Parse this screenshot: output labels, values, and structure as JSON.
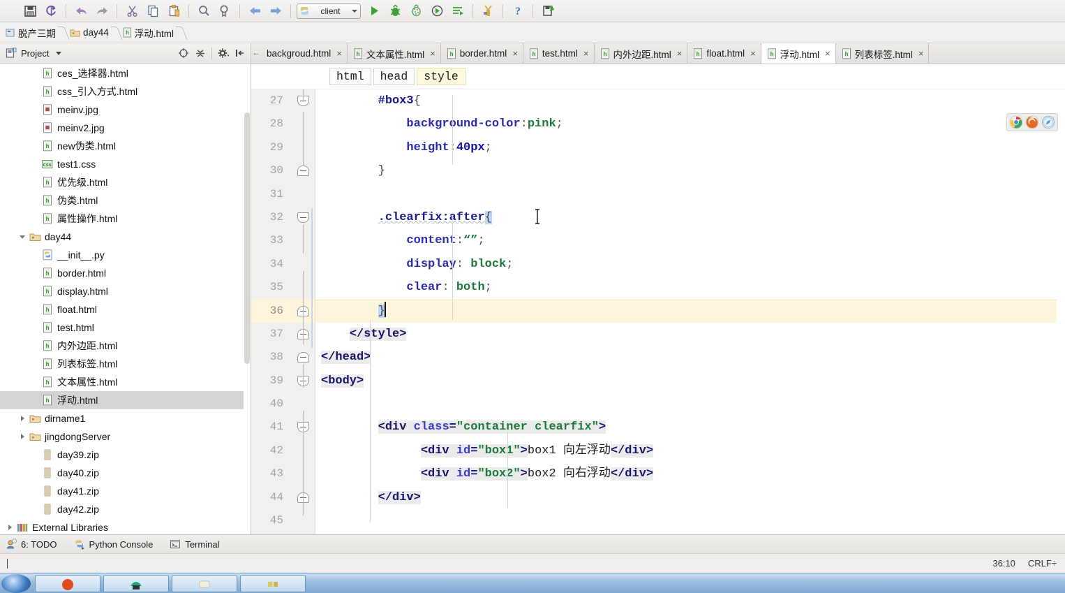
{
  "toolbar": {
    "icons": [
      {
        "name": "save-all-icon",
        "title": "Save All"
      },
      {
        "name": "sync-refresh-icon",
        "title": "Synchronize"
      },
      {
        "name": "undo-icon",
        "title": "Undo"
      },
      {
        "name": "redo-icon",
        "title": "Redo"
      },
      {
        "name": "cut-icon",
        "title": "Cut"
      },
      {
        "name": "copy-icon",
        "title": "Copy"
      },
      {
        "name": "paste-icon",
        "title": "Paste"
      },
      {
        "name": "find-icon",
        "title": "Find"
      },
      {
        "name": "replace-icon",
        "title": "Replace"
      },
      {
        "name": "back-icon",
        "title": "Back"
      },
      {
        "name": "forward-icon",
        "title": "Forward"
      }
    ],
    "run_config": "client",
    "run_icons": [
      {
        "name": "run-icon",
        "title": "Run"
      },
      {
        "name": "debug-icon",
        "title": "Debug"
      },
      {
        "name": "coverage-icon",
        "title": "Run with Coverage"
      },
      {
        "name": "profile-icon",
        "title": "Profile"
      },
      {
        "name": "run-console-icon",
        "title": "Run Console"
      },
      {
        "name": "attach-process-icon",
        "title": "Attach"
      },
      {
        "name": "help-icon",
        "title": "Help"
      },
      {
        "name": "deploy-icon",
        "title": "Deploy"
      }
    ]
  },
  "breadcrumb": {
    "items": [
      {
        "label": "脱产三期",
        "icon": "project-icon"
      },
      {
        "label": "day44",
        "icon": "folder-icon"
      },
      {
        "label": "浮动.html",
        "icon": "html-file-icon"
      }
    ]
  },
  "sidebar": {
    "panel_title": "Project",
    "header_icons": [
      {
        "name": "locate-target-icon"
      },
      {
        "name": "collapse-all-icon"
      },
      {
        "name": "settings-gear-icon"
      },
      {
        "name": "hide-panel-icon"
      }
    ],
    "tree": [
      {
        "label": "ces_选择器.html",
        "icon": "html-file-icon",
        "indent": 2,
        "arrow": "none",
        "selected": false
      },
      {
        "label": "css_引入方式.html",
        "icon": "html-file-icon",
        "indent": 2,
        "arrow": "none",
        "selected": false
      },
      {
        "label": "meinv.jpg",
        "icon": "image-file-icon",
        "indent": 2,
        "arrow": "none",
        "selected": false
      },
      {
        "label": "meinv2.jpg",
        "icon": "image-file-icon",
        "indent": 2,
        "arrow": "none",
        "selected": false
      },
      {
        "label": "new伪类.html",
        "icon": "html-file-icon",
        "indent": 2,
        "arrow": "none",
        "selected": false
      },
      {
        "label": "test1.css",
        "icon": "css-file-icon",
        "indent": 2,
        "arrow": "none",
        "selected": false
      },
      {
        "label": "优先级.html",
        "icon": "html-file-icon",
        "indent": 2,
        "arrow": "none",
        "selected": false
      },
      {
        "label": "伪类.html",
        "icon": "html-file-icon",
        "indent": 2,
        "arrow": "none",
        "selected": false
      },
      {
        "label": "属性操作.html",
        "icon": "html-file-icon",
        "indent": 2,
        "arrow": "none",
        "selected": false
      },
      {
        "label": "day44",
        "icon": "folder-icon",
        "indent": 1,
        "arrow": "open",
        "selected": false
      },
      {
        "label": "__init__.py",
        "icon": "python-file-icon",
        "indent": 2,
        "arrow": "none",
        "selected": false
      },
      {
        "label": "border.html",
        "icon": "html-file-icon",
        "indent": 2,
        "arrow": "none",
        "selected": false
      },
      {
        "label": "display.html",
        "icon": "html-file-icon",
        "indent": 2,
        "arrow": "none",
        "selected": false
      },
      {
        "label": "float.html",
        "icon": "html-file-icon",
        "indent": 2,
        "arrow": "none",
        "selected": false
      },
      {
        "label": "test.html",
        "icon": "html-file-icon",
        "indent": 2,
        "arrow": "none",
        "selected": false
      },
      {
        "label": "内外边距.html",
        "icon": "html-file-icon",
        "indent": 2,
        "arrow": "none",
        "selected": false
      },
      {
        "label": "列表标签.html",
        "icon": "html-file-icon",
        "indent": 2,
        "arrow": "none",
        "selected": false
      },
      {
        "label": "文本属性.html",
        "icon": "html-file-icon",
        "indent": 2,
        "arrow": "none",
        "selected": false
      },
      {
        "label": "浮动.html",
        "icon": "html-file-icon",
        "indent": 2,
        "arrow": "none",
        "selected": true
      },
      {
        "label": "dirname1",
        "icon": "folder-icon",
        "indent": 1,
        "arrow": "closed",
        "selected": false
      },
      {
        "label": "jingdongServer",
        "icon": "folder-icon",
        "indent": 1,
        "arrow": "closed",
        "selected": false
      },
      {
        "label": "day39.zip",
        "icon": "zip-file-icon",
        "indent": 2,
        "arrow": "none",
        "selected": false
      },
      {
        "label": "day40.zip",
        "icon": "zip-file-icon",
        "indent": 2,
        "arrow": "none",
        "selected": false
      },
      {
        "label": "day41.zip",
        "icon": "zip-file-icon",
        "indent": 2,
        "arrow": "none",
        "selected": false
      },
      {
        "label": "day42.zip",
        "icon": "zip-file-icon",
        "indent": 2,
        "arrow": "none",
        "selected": false
      },
      {
        "label": "External Libraries",
        "icon": "libraries-icon",
        "indent": 0,
        "arrow": "closed",
        "selected": false
      }
    ]
  },
  "editor": {
    "tabs": [
      {
        "label": "backgroud.html",
        "icon": "html-file-icon",
        "active": false,
        "clipped": true
      },
      {
        "label": "文本属性.html",
        "icon": "html-file-icon",
        "active": false,
        "clipped": false
      },
      {
        "label": "border.html",
        "icon": "html-file-icon",
        "active": false,
        "clipped": false
      },
      {
        "label": "test.html",
        "icon": "html-file-icon",
        "active": false,
        "clipped": false
      },
      {
        "label": "内外边距.html",
        "icon": "html-file-icon",
        "active": false,
        "clipped": false
      },
      {
        "label": "float.html",
        "icon": "html-file-icon",
        "active": false,
        "clipped": false
      },
      {
        "label": "浮动.html",
        "icon": "html-file-icon",
        "active": true,
        "clipped": false
      },
      {
        "label": "列表标签.html",
        "icon": "html-file-icon",
        "active": false,
        "clipped": false
      }
    ],
    "tab_close_label": "×",
    "structure_crumbs": [
      {
        "label": "html",
        "highlighted": false
      },
      {
        "label": "head",
        "highlighted": false
      },
      {
        "label": "style",
        "highlighted": true
      }
    ],
    "browsers": [
      {
        "name": "chrome-browser-icon"
      },
      {
        "name": "firefox-browser-icon"
      },
      {
        "name": "safari-browser-icon"
      }
    ],
    "first_line_number": 27,
    "current_line": 36,
    "lines": [
      {
        "n": 27,
        "text": "        #box3{"
      },
      {
        "n": 28,
        "text": "            background-color:pink;",
        "breakpoint": true
      },
      {
        "n": 29,
        "text": "            height:40px;"
      },
      {
        "n": 30,
        "text": "        }"
      },
      {
        "n": 31,
        "text": ""
      },
      {
        "n": 32,
        "text": "        .clearfix:after{"
      },
      {
        "n": 33,
        "text": "            content:“”;"
      },
      {
        "n": 34,
        "text": "            display: block;"
      },
      {
        "n": 35,
        "text": "            clear: both;"
      },
      {
        "n": 36,
        "text": "        }",
        "current": true
      },
      {
        "n": 37,
        "text": "    </style>"
      },
      {
        "n": 38,
        "text": "</head>"
      },
      {
        "n": 39,
        "text": "<body>"
      },
      {
        "n": 40,
        "text": ""
      },
      {
        "n": 41,
        "text": "        <div class=\"container clearfix\">"
      },
      {
        "n": 42,
        "text": "              <div id=\"box1\">box1 向左浮动</div>"
      },
      {
        "n": 43,
        "text": "              <div id=\"box2\">box2 向右浮动</div>"
      },
      {
        "n": 44,
        "text": "        </div>"
      },
      {
        "n": 45,
        "text": ""
      }
    ]
  },
  "bottom_tools": [
    {
      "label": "6: TODO",
      "accesskey": "6",
      "icon": "todo-icon"
    },
    {
      "label": "Python Console",
      "icon": "python-console-icon"
    },
    {
      "label": "Terminal",
      "icon": "terminal-icon"
    }
  ],
  "statusbar": {
    "caret_position": "36:10",
    "line_separator": "CRLF÷"
  },
  "colors": {
    "selection_tree": "#d4d4d4",
    "current_line": "#fdf6dd",
    "breakpoint": "#f2a6a6",
    "brace_match": "#bcd6f7",
    "css_value": "#1d7a3c",
    "css_property": "#2b2bb0",
    "tag": "#16166e",
    "attr": "#3a3ad0",
    "taskbar": "#9dbfe0"
  }
}
